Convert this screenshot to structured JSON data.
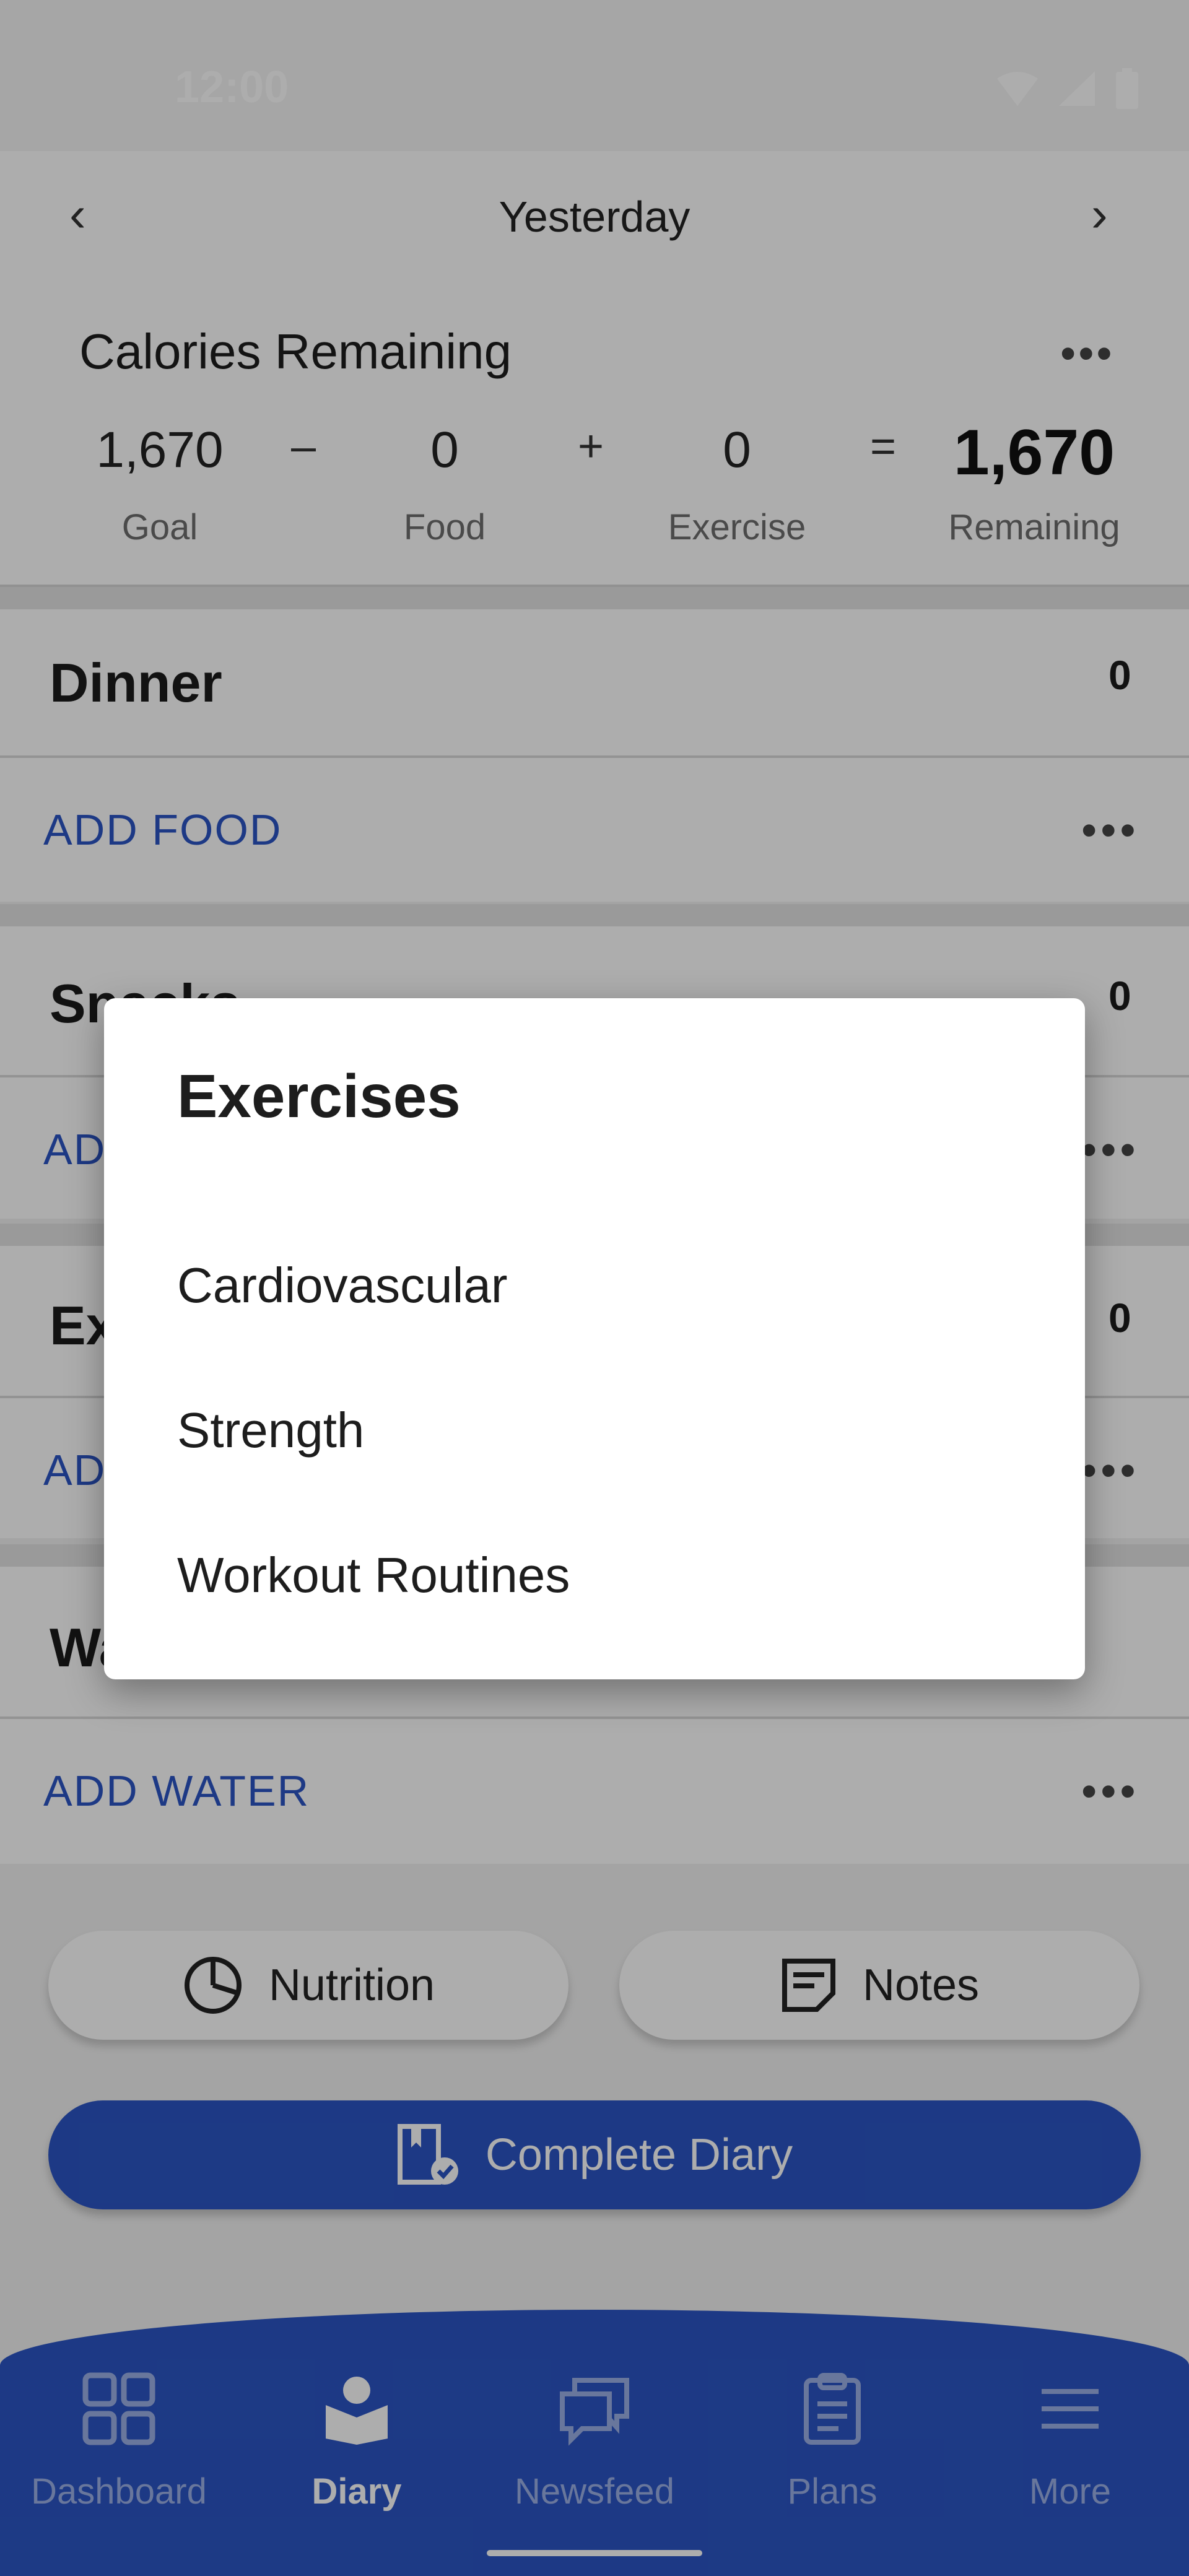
{
  "status": {
    "time": "12:00",
    "icons": [
      "wifi-icon",
      "signal-icon",
      "battery-icon"
    ]
  },
  "header": {
    "date_label": "Yesterday"
  },
  "calories": {
    "title": "Calories Remaining",
    "goal_value": "1,670",
    "goal_label": "Goal",
    "minus": "–",
    "food_value": "0",
    "food_label": "Food",
    "plus": "+",
    "exercise_value": "0",
    "exercise_label": "Exercise",
    "equals": "=",
    "remaining_value": "1,670",
    "remaining_label": "Remaining"
  },
  "sections": {
    "dinner": {
      "title": "Dinner",
      "count": "0",
      "action": "ADD FOOD"
    },
    "snacks": {
      "title": "Snacks",
      "count": "0",
      "action": "ADD FOOD"
    },
    "exercise": {
      "title": "Exercise",
      "count": "0",
      "action": "ADD EXERCISE"
    },
    "water": {
      "title": "Water",
      "action": "ADD WATER"
    }
  },
  "buttons": {
    "nutrition": "Nutrition",
    "notes": "Notes",
    "complete": "Complete Diary"
  },
  "nav": {
    "items": [
      {
        "label": "Dashboard",
        "icon": "dashboard-icon"
      },
      {
        "label": "Diary",
        "icon": "diary-icon",
        "active": true
      },
      {
        "label": "Newsfeed",
        "icon": "newsfeed-icon"
      },
      {
        "label": "Plans",
        "icon": "plans-icon"
      },
      {
        "label": "More",
        "icon": "menu-icon"
      }
    ]
  },
  "dialog": {
    "title": "Exercises",
    "options": [
      "Cardiovascular",
      "Strength",
      "Workout Routines"
    ]
  },
  "colors": {
    "accent": "#2b55c4",
    "scrim": "rgba(0,0,0,0.32)"
  }
}
